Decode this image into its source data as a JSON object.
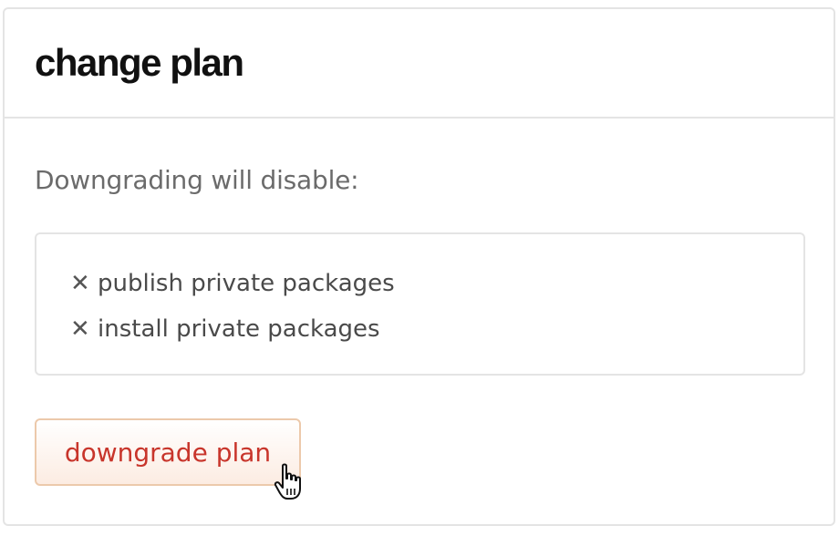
{
  "dialog": {
    "title": "change plan",
    "intro": "Downgrading will disable:",
    "features": [
      {
        "icon": "x-icon",
        "label": "publish private packages"
      },
      {
        "icon": "x-icon",
        "label": "install private packages"
      }
    ],
    "downgrade_button_label": "downgrade plan",
    "colors": {
      "button_text": "#c8352b",
      "button_border": "#ecc9ab",
      "border": "#e4e4e4"
    }
  }
}
